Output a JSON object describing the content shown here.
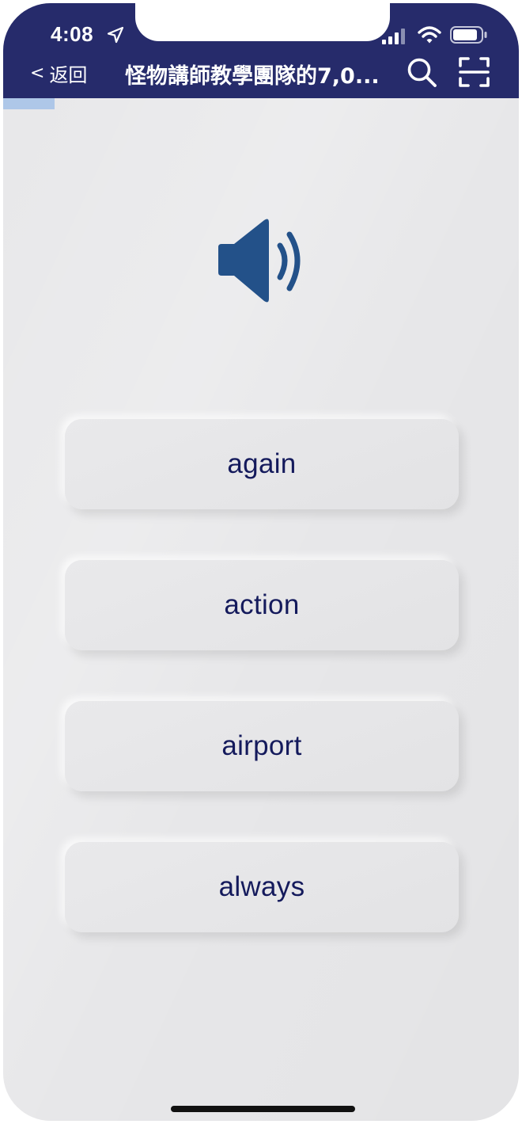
{
  "status_bar": {
    "time": "4:08",
    "icons": [
      "location-arrow-icon",
      "cellular-signal-icon",
      "wifi-icon",
      "battery-icon"
    ]
  },
  "nav": {
    "back_label": "返回",
    "back_icon": "chevron-left-icon",
    "title": "怪物講師教學團隊的7,0...",
    "actions": [
      "search-icon",
      "scan-icon"
    ]
  },
  "quiz": {
    "progress_fraction": 0.1,
    "audio_icon": "speaker-icon",
    "options": [
      {
        "label": "again"
      },
      {
        "label": "action"
      },
      {
        "label": "airport"
      },
      {
        "label": "always"
      }
    ]
  },
  "colors": {
    "header_bg": "#262b6b",
    "screen_bg": "#e7e7e9",
    "speaker": "#235189",
    "option_text": "#141a5c",
    "progress": "#aec7e8"
  }
}
